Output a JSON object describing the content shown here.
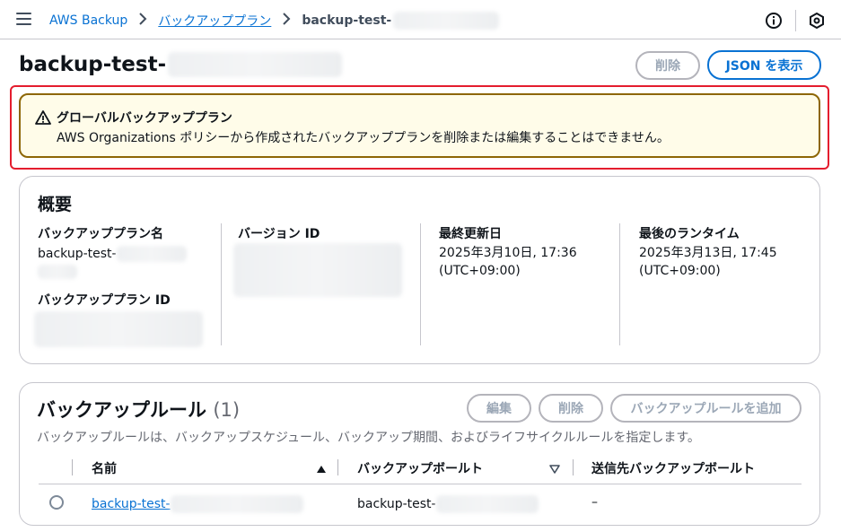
{
  "breadcrumb": {
    "root": "AWS Backup",
    "plans": "バックアッププラン",
    "current": "backup-test-"
  },
  "page": {
    "title": "backup-test-",
    "delete_label": "削除",
    "json_label": "JSON を表示"
  },
  "alert": {
    "title": "グローバルバックアッププラン",
    "message": "AWS Organizations ポリシーから作成されたバックアッププランを削除または編集することはできません。"
  },
  "overview": {
    "title": "概要",
    "plan_name_label": "バックアッププラン名",
    "plan_name_value": "backup-test-",
    "plan_id_label": "バックアッププラン ID",
    "version_label": "バージョン ID",
    "updated_label": "最終更新日",
    "updated_value_1": "2025年3月10日, 17:36",
    "updated_value_2": "(UTC+09:00)",
    "runtime_label": "最後のランタイム",
    "runtime_value_1": "2025年3月13日, 17:45",
    "runtime_value_2": "(UTC+09:00)"
  },
  "rules": {
    "title": "バックアップルール",
    "count": "(1)",
    "edit_label": "編集",
    "delete_label": "削除",
    "add_label": "バックアップルールを追加",
    "description": "バックアップルールは、バックアップスケジュール、バックアップ期間、およびライフサイクルルールを指定します。",
    "columns": {
      "name": "名前",
      "vault": "バックアップボールト",
      "dest": "送信先バックアップボールト"
    },
    "row": {
      "name": "backup-test-",
      "vault": "backup-test-",
      "dest": "–"
    }
  },
  "colors": {
    "link": "#0972d3",
    "warning_border": "#8d6605",
    "warning_bg": "#fffce9",
    "highlight": "#e41d2e"
  }
}
